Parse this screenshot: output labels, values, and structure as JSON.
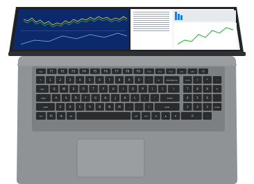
{
  "image": {
    "subject": "laptop-top-view",
    "colors": {
      "chassis": "#8f9396",
      "chassis_dark": "#6f7376",
      "bezel": "#2b2d30",
      "key": "#2a2b2d",
      "key_text": "#cfd1d3",
      "screen_left_bg": "#0c2a6b",
      "screen_right_bg": "#f4f6f7",
      "chart_green": "#2fbf3f",
      "chart_yellow": "#e9d24a",
      "chart_blue": "#2b7bd1"
    }
  },
  "keyboard": {
    "row1": [
      "esc",
      "F1",
      "F2",
      "F3",
      "F4",
      "F5",
      "F6",
      "F7",
      "F8",
      "F9",
      "F10",
      "F11",
      "F12",
      "ins",
      "del",
      "⏻"
    ],
    "row2": [
      "~",
      "1",
      "2",
      "3",
      "4",
      "5",
      "6",
      "7",
      "8",
      "9",
      "0",
      "-",
      "=",
      "backspace"
    ],
    "row3": [
      "tab",
      "Q",
      "W",
      "E",
      "R",
      "T",
      "Y",
      "U",
      "I",
      "O",
      "P",
      "[",
      "]",
      "\\"
    ],
    "row4": [
      "caps",
      "A",
      "S",
      "D",
      "F",
      "G",
      "H",
      "J",
      "K",
      "L",
      ";",
      "'",
      "enter"
    ],
    "row5": [
      "shift",
      "Z",
      "X",
      "C",
      "V",
      "B",
      "N",
      "M",
      ",",
      ".",
      "/",
      "shift"
    ],
    "row6": [
      "ctrl",
      "fn",
      "⊞",
      "alt",
      "",
      "alt",
      "ctrl",
      "◂",
      "▴",
      "▾",
      "▸"
    ],
    "numpad": [
      [
        "num",
        "/",
        "*",
        "-"
      ],
      [
        "7",
        "8",
        "9",
        "+"
      ],
      [
        "4",
        "5",
        "6",
        ""
      ],
      [
        "1",
        "2",
        "3",
        "enter"
      ],
      [
        "0",
        ".",
        "",
        ""
      ]
    ]
  }
}
